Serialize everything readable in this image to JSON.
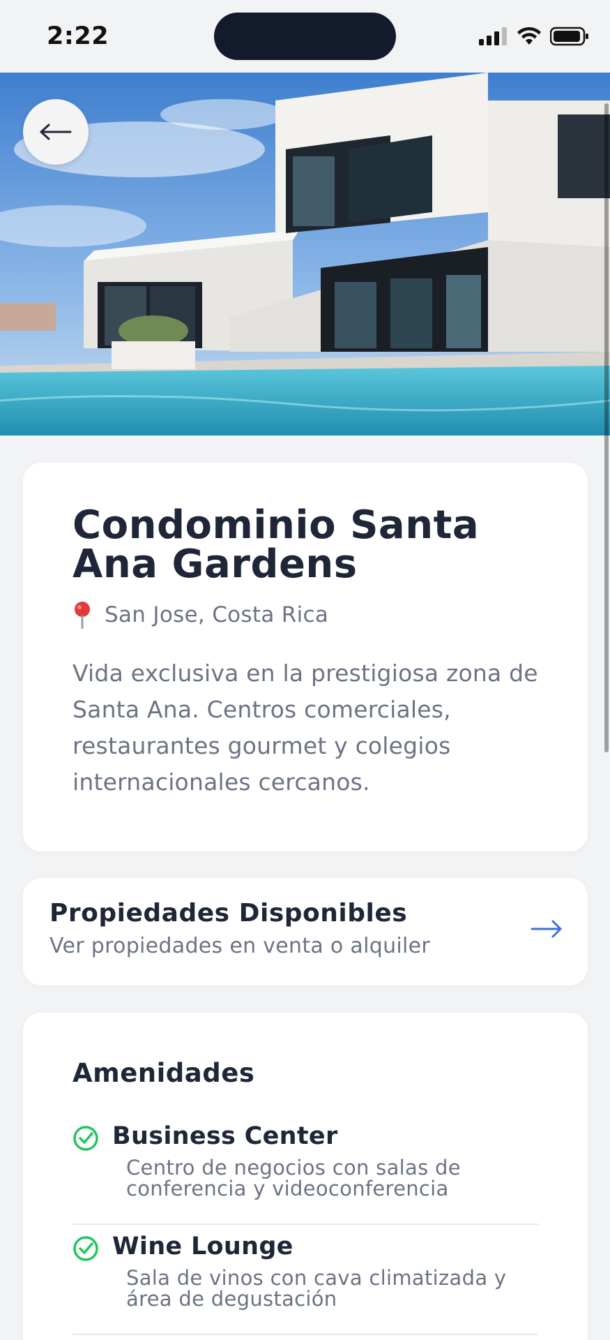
{
  "status_bar": {
    "time": "2:22"
  },
  "property": {
    "name": "Condominio Santa Ana Gardens",
    "location": "San Jose, Costa Rica",
    "description": "Vida exclusiva en la prestigiosa zona de Santa Ana. Centros comerciales, restaurantes gourmet y colegios internacionales cercanos."
  },
  "properties_link": {
    "title": "Propiedades Disponibles",
    "subtitle": "Ver propiedades en venta o alquiler"
  },
  "amenities": {
    "title": "Amenidades",
    "items": [
      {
        "name": "Business Center",
        "description": "Centro de negocios con salas de conferencia y videoconferencia"
      },
      {
        "name": "Wine Lounge",
        "description": "Sala de vinos con cava climatizada y área de degustación"
      }
    ]
  },
  "colors": {
    "accent": "#3b6fd8",
    "check": "#22c55e",
    "text_dark": "#1e2638",
    "text_muted": "#6b7383"
  }
}
